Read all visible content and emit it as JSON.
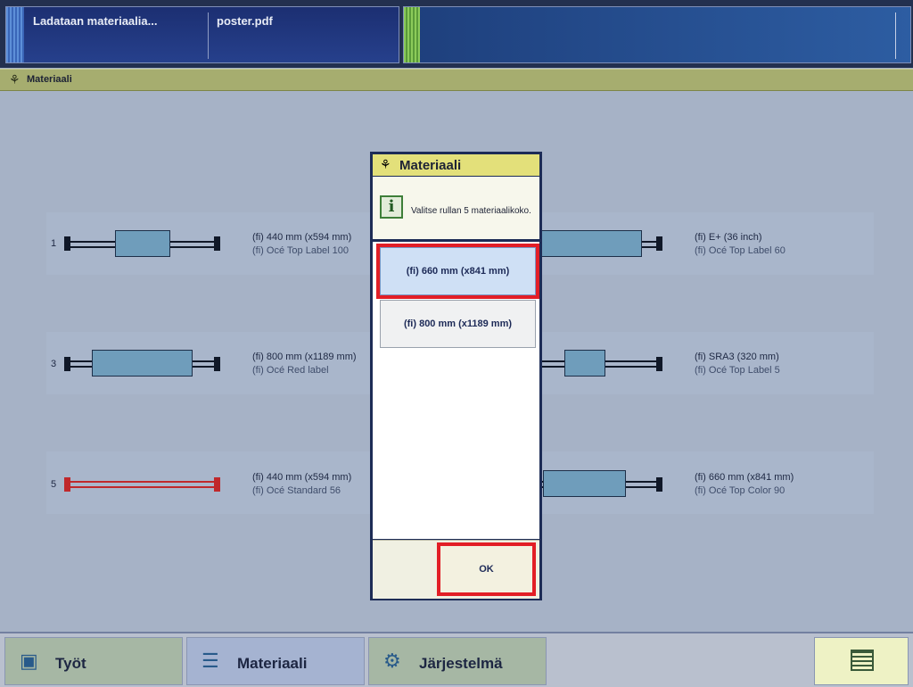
{
  "status": {
    "job_text": "Ladataan materiaalia...",
    "file_text": "poster.pdf"
  },
  "title": {
    "icon": "material-roll-icon",
    "text": "Materiaali"
  },
  "rolls": [
    {
      "number": "1",
      "size": "(fi) 440 mm (x594 mm)",
      "name": "(fi) Océ Top Label 100"
    },
    {
      "number": "",
      "size": "(fi) E+ (36 inch)",
      "name": "(fi) Océ Top Label 60"
    },
    {
      "number": "3",
      "size": "(fi) 800 mm (x1189 mm)",
      "name": "(fi) Océ Red label"
    },
    {
      "number": "",
      "size": "(fi) SRA3 (320 mm)",
      "name": "(fi) Océ Top Label 5"
    },
    {
      "number": "5",
      "size": "(fi) 440 mm (x594 mm)",
      "name": "(fi) Océ Standard 56"
    },
    {
      "number": "",
      "size": "(fi) 660 mm (x841 mm)",
      "name": "(fi) Océ Top Color 90"
    }
  ],
  "dialog": {
    "title": "Materiaali",
    "message": "Valitse rullan 5 materiaalikoko.",
    "options": [
      {
        "label": "(fi) 660 mm (x841 mm)",
        "selected": true
      },
      {
        "label": "(fi) 800 mm (x1189 mm)",
        "selected": false
      }
    ],
    "ok_label": "OK"
  },
  "nav": {
    "jobs": "Työt",
    "material": "Materiaali",
    "system": "Järjestelmä"
  },
  "colors": {
    "highlight": "#e21e26",
    "roll_paper": "#6f9dbb",
    "roll_empty": "#c0282b"
  }
}
